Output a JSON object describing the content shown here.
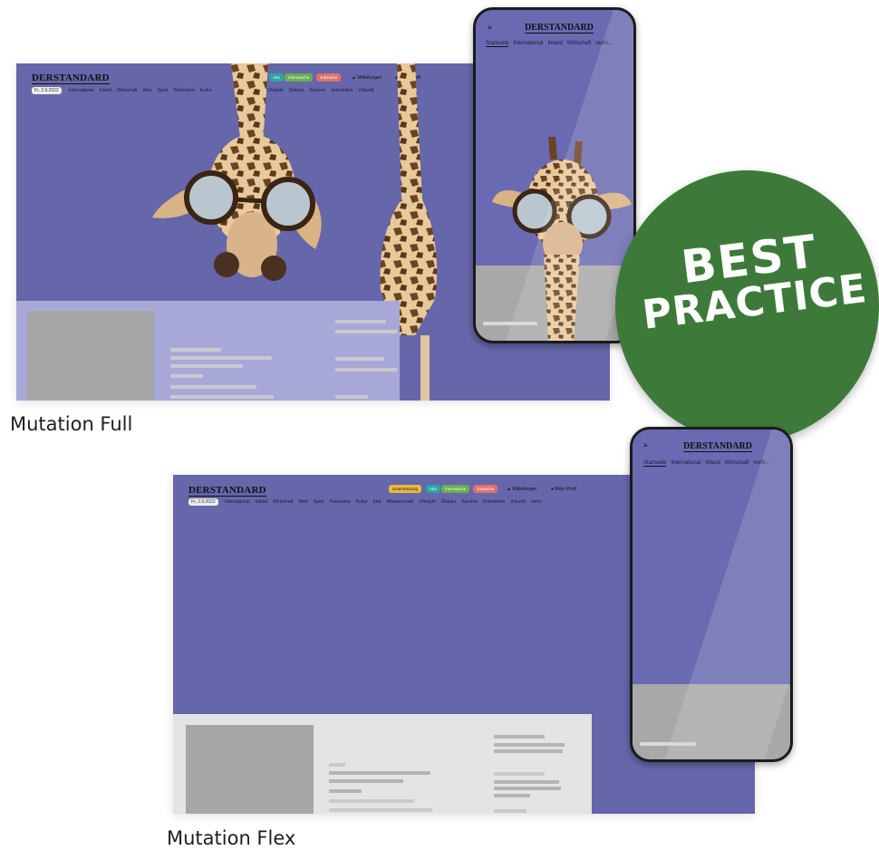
{
  "captions": {
    "full": "Mutation Full",
    "flex": "Mutation Flex"
  },
  "badge": {
    "line1": "BEST",
    "line2": "PRACTICE",
    "color": "#3d7a3a"
  },
  "desktop": {
    "logo": "DERSTANDARD",
    "date": "Fr, 2.9.2022",
    "nav": [
      "International",
      "Inland",
      "Wirtschaft",
      "Web",
      "Sport",
      "Panorama",
      "Kultur",
      "Etat",
      "Wissenschaft",
      "Lifestyle",
      "Diskurs",
      "Karriere",
      "Immobilien",
      "Zukunft",
      "mehr"
    ],
    "pills": [
      {
        "label": "Unterstützung",
        "color": "#e8b93a"
      },
      {
        "label": "Abo",
        "color": "#2aa6a6"
      },
      {
        "label": "Immosuche",
        "color": "#6ab04c"
      },
      {
        "label": "Jobsuche",
        "color": "#e07070"
      }
    ],
    "links": {
      "watchlist": "Mitteilungen",
      "profile": "Mein Profil"
    },
    "background": "#6666aa"
  },
  "phone": {
    "logo": "DERSTANDARD",
    "menu_icon": "≡",
    "tabs": [
      "Startseite",
      "International",
      "Inland",
      "Wirtschaft",
      "mehr..."
    ]
  }
}
